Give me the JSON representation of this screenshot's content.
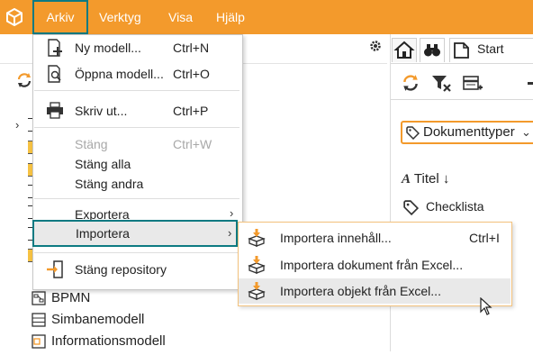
{
  "menubar": {
    "items": [
      {
        "label": "Arkiv"
      },
      {
        "label": "Verktyg"
      },
      {
        "label": "Visa"
      },
      {
        "label": "Hjälp"
      }
    ]
  },
  "arkiv_menu": {
    "items": [
      {
        "label": "Ny modell...",
        "shortcut": "Ctrl+N",
        "icon": "new-model-icon",
        "enabled": true
      },
      {
        "label": "Öppna modell...",
        "shortcut": "Ctrl+O",
        "icon": "open-model-icon",
        "enabled": true
      },
      {
        "label": "Skriv ut...",
        "shortcut": "Ctrl+P",
        "icon": "printer-icon",
        "enabled": true
      },
      {
        "label": "Stäng",
        "shortcut": "Ctrl+W",
        "enabled": false
      },
      {
        "label": "Stäng alla",
        "enabled": true
      },
      {
        "label": "Stäng andra",
        "enabled": true
      },
      {
        "label": "Exportera",
        "submenu": true,
        "enabled": true
      },
      {
        "label": "Importera",
        "submenu": true,
        "enabled": true,
        "highlighted": true
      },
      {
        "label": "Stäng repository",
        "icon": "close-repository-icon",
        "enabled": true
      }
    ]
  },
  "import_submenu": {
    "items": [
      {
        "label": "Importera innehåll...",
        "shortcut": "Ctrl+I",
        "icon": "import-box-icon"
      },
      {
        "label": "Importera dokument från Excel...",
        "icon": "import-box-icon"
      },
      {
        "label": "Importera objekt från Excel...",
        "icon": "import-box-icon",
        "hovered": true
      }
    ]
  },
  "tree": {
    "items": [
      {
        "label": "BPMN",
        "icon": "bpmn-diagram-icon"
      },
      {
        "label": "Simbanemodell",
        "icon": "swimlane-model-icon"
      },
      {
        "label": "Informationsmodell",
        "icon": "information-model-icon"
      }
    ]
  },
  "right_panel": {
    "start_tab": "Start",
    "dropdown_value": "Dokumenttyper",
    "column_header": "Titel",
    "sort_indicator": "↓",
    "list": [
      "Checklista"
    ]
  },
  "colors": {
    "accent_orange": "#f39a2c",
    "highlight_teal": "#0d7a82",
    "menu_hover": "#e9e9e9"
  }
}
